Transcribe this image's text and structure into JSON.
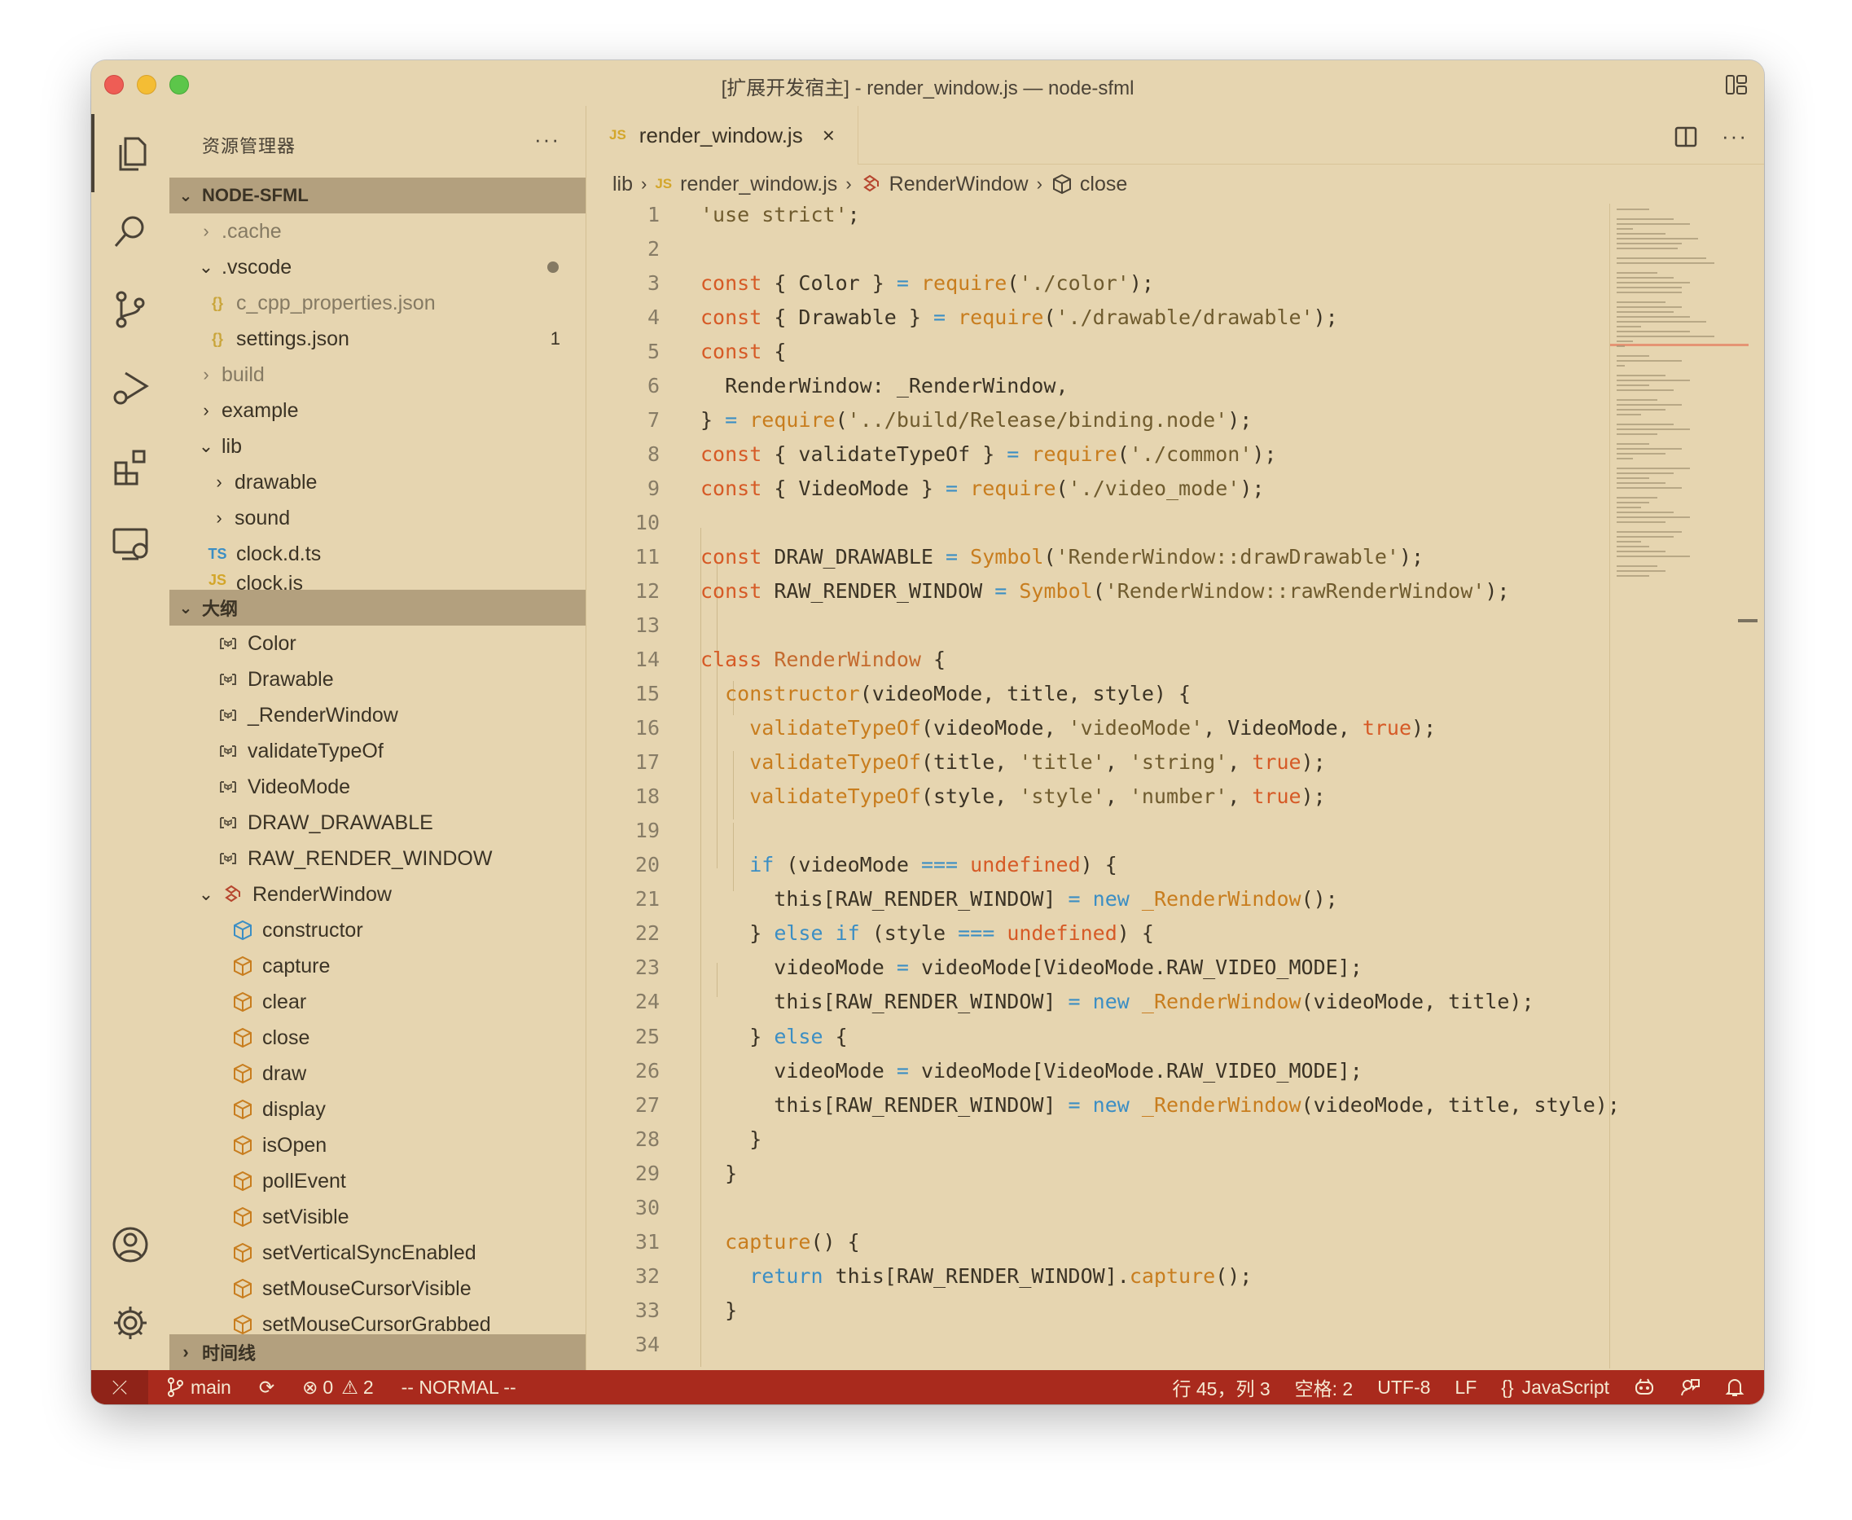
{
  "window": {
    "title": "[扩展开发宿主] - render_window.js — node-sfml"
  },
  "sidebar": {
    "title": "资源管理器",
    "more": "···",
    "explorer_section": "NODE-SFML",
    "files": [
      {
        "label": ".cache",
        "arrow": "›"
      },
      {
        "label": ".vscode",
        "arrow": "⌄"
      },
      {
        "label": "c_cpp_properties.json",
        "icon": "{}"
      },
      {
        "label": "settings.json",
        "icon": "{}",
        "badge": "1"
      },
      {
        "label": "build",
        "arrow": "›"
      },
      {
        "label": "example",
        "arrow": "›"
      },
      {
        "label": "lib",
        "arrow": "⌄"
      },
      {
        "label": "drawable",
        "arrow": "›"
      },
      {
        "label": "sound",
        "arrow": "›"
      },
      {
        "label": "clock.d.ts",
        "icon": "TS"
      },
      {
        "label": "clock.js",
        "icon": "JS"
      }
    ],
    "outline_section": "大纲",
    "outline": [
      "Color",
      "Drawable",
      "_RenderWindow",
      "validateTypeOf",
      "VideoMode",
      "DRAW_DRAWABLE",
      "RAW_RENDER_WINDOW",
      "RenderWindow",
      "constructor",
      "capture",
      "clear",
      "close",
      "draw",
      "display",
      "isOpen",
      "pollEvent",
      "setVisible",
      "setVerticalSyncEnabled",
      "setMouseCursorVisible",
      "setMouseCursorGrabbed"
    ],
    "timeline_section": "时间线"
  },
  "editor": {
    "tab_label": "render_window.js",
    "tab_icon": "JS",
    "tab_close": "×",
    "more": "···",
    "breadcrumb": {
      "lib": "lib",
      "file": "render_window.js",
      "class": "RenderWindow",
      "method": "close",
      "file_icon": "JS"
    },
    "line_numbers": [
      "1",
      "2",
      "3",
      "4",
      "5",
      "6",
      "7",
      "8",
      "9",
      "10",
      "11",
      "12",
      "13",
      "14",
      "15",
      "16",
      "17",
      "18",
      "19",
      "20",
      "21",
      "22",
      "23",
      "24",
      "25",
      "26",
      "27",
      "28",
      "29",
      "30",
      "31",
      "32",
      "33",
      "34"
    ]
  },
  "statusbar": {
    "remote": "⤫",
    "branch": "main",
    "sync": "⟳",
    "errors": "0",
    "warnings": "2",
    "mode": "-- NORMAL --",
    "position": "行 45，列 3",
    "spaces": "空格: 2",
    "encoding": "UTF-8",
    "eol": "LF",
    "language": "JavaScript",
    "lang_icon": "{}"
  },
  "colors": {
    "window_bg": "#e6d5b0",
    "statusbar_bg": "#a92a1d",
    "section_bg": "#b3a07e"
  }
}
